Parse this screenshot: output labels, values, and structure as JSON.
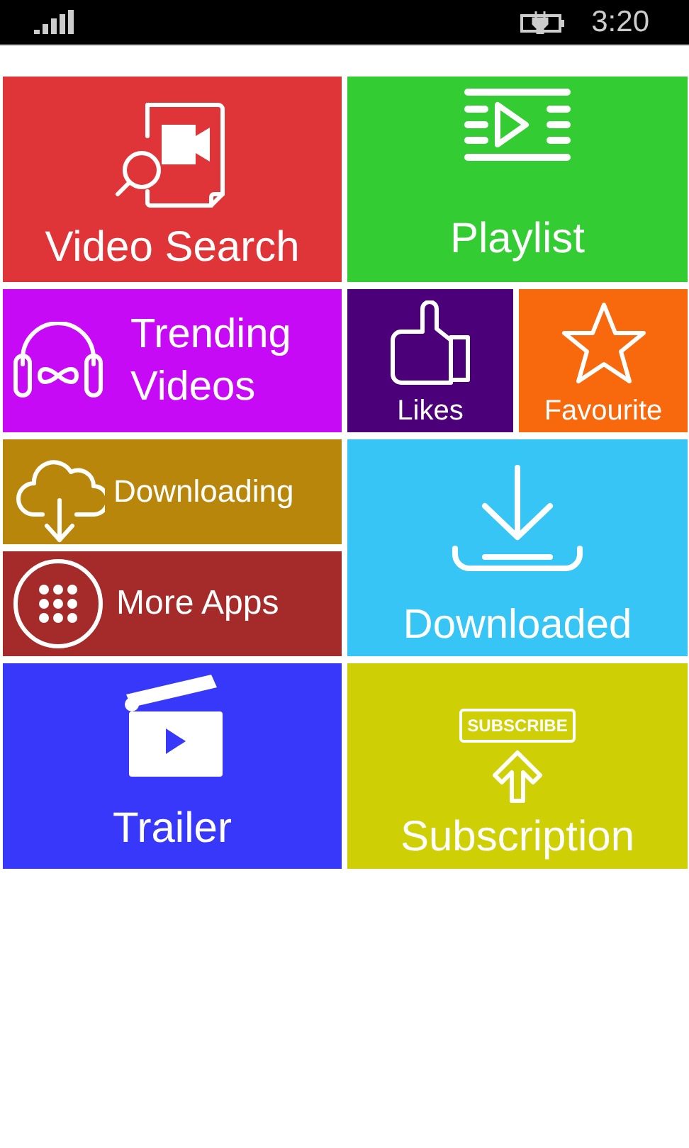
{
  "status_bar": {
    "time": "3:20"
  },
  "tiles": [
    {
      "kind": "video_search",
      "label": "Video Search",
      "color": "#e03538"
    },
    {
      "kind": "playlist",
      "label": "Playlist",
      "color": "#33cc33"
    },
    {
      "kind": "trending",
      "label": "Trending Videos",
      "color": "#c70af5"
    },
    {
      "kind": "likes",
      "label": "Likes",
      "color": "#4b0079"
    },
    {
      "kind": "favourite",
      "label": "Favourite",
      "color": "#f8680c"
    },
    {
      "kind": "downloading",
      "label": "Downloading",
      "color": "#b8860b"
    },
    {
      "kind": "downloaded",
      "label": "Downloaded",
      "color": "#36c5f5"
    },
    {
      "kind": "more_apps",
      "label": "More Apps",
      "color": "#a52a2a"
    },
    {
      "kind": "trailer",
      "label": "Trailer",
      "color": "#3838fa"
    },
    {
      "kind": "subscription",
      "label": "Subscription",
      "color": "#cfcf05",
      "badge": "SUBSCRIBE"
    }
  ]
}
